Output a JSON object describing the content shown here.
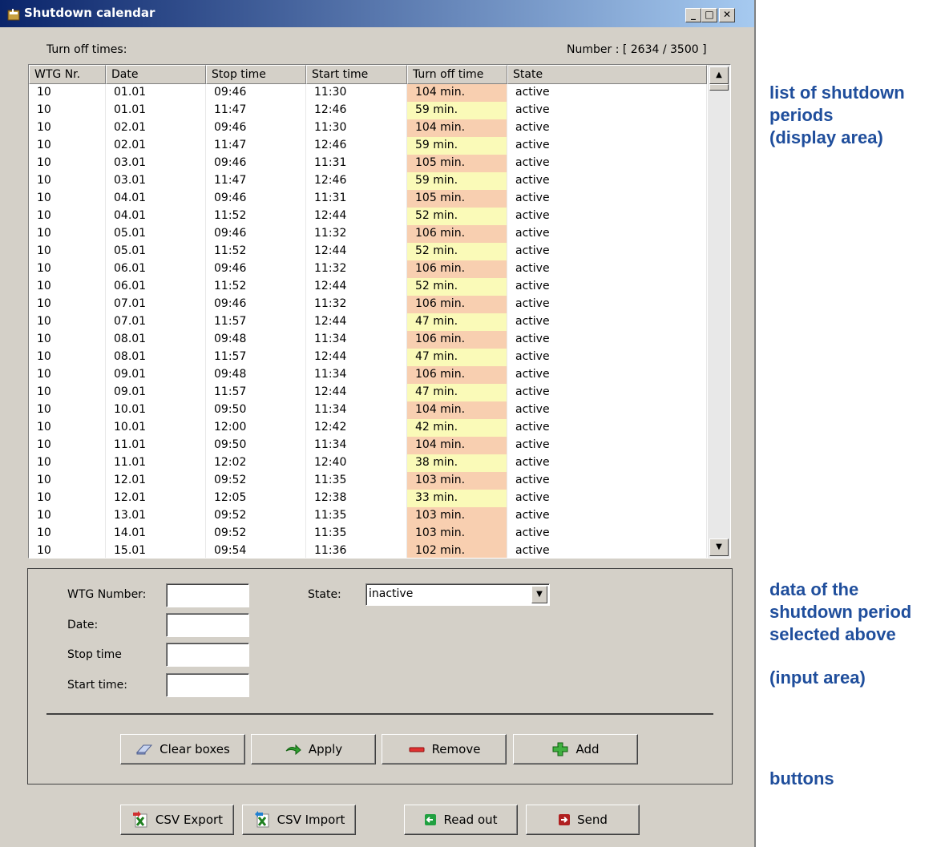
{
  "window": {
    "title": "Shutdown calendar",
    "controls": {
      "minimize": "_",
      "maximize": "□",
      "close": "✕"
    }
  },
  "list": {
    "label": "Turn off times:",
    "count_text": "Number : [ 2634 / 3500 ]",
    "columns": [
      "WTG Nr.",
      "Date",
      "Stop time",
      "Start time",
      "Turn off time",
      "State"
    ],
    "rows": [
      {
        "wtg": "10",
        "date": "01.01",
        "stop": "09:46",
        "start": "11:30",
        "off": "104 min.",
        "state": "active"
      },
      {
        "wtg": "10",
        "date": "01.01",
        "stop": "11:47",
        "start": "12:46",
        "off": "59 min.",
        "state": "active"
      },
      {
        "wtg": "10",
        "date": "02.01",
        "stop": "09:46",
        "start": "11:30",
        "off": "104 min.",
        "state": "active"
      },
      {
        "wtg": "10",
        "date": "02.01",
        "stop": "11:47",
        "start": "12:46",
        "off": "59 min.",
        "state": "active"
      },
      {
        "wtg": "10",
        "date": "03.01",
        "stop": "09:46",
        "start": "11:31",
        "off": "105 min.",
        "state": "active"
      },
      {
        "wtg": "10",
        "date": "03.01",
        "stop": "11:47",
        "start": "12:46",
        "off": "59 min.",
        "state": "active"
      },
      {
        "wtg": "10",
        "date": "04.01",
        "stop": "09:46",
        "start": "11:31",
        "off": "105 min.",
        "state": "active"
      },
      {
        "wtg": "10",
        "date": "04.01",
        "stop": "11:52",
        "start": "12:44",
        "off": "52 min.",
        "state": "active"
      },
      {
        "wtg": "10",
        "date": "05.01",
        "stop": "09:46",
        "start": "11:32",
        "off": "106 min.",
        "state": "active"
      },
      {
        "wtg": "10",
        "date": "05.01",
        "stop": "11:52",
        "start": "12:44",
        "off": "52 min.",
        "state": "active"
      },
      {
        "wtg": "10",
        "date": "06.01",
        "stop": "09:46",
        "start": "11:32",
        "off": "106 min.",
        "state": "active"
      },
      {
        "wtg": "10",
        "date": "06.01",
        "stop": "11:52",
        "start": "12:44",
        "off": "52 min.",
        "state": "active"
      },
      {
        "wtg": "10",
        "date": "07.01",
        "stop": "09:46",
        "start": "11:32",
        "off": "106 min.",
        "state": "active"
      },
      {
        "wtg": "10",
        "date": "07.01",
        "stop": "11:57",
        "start": "12:44",
        "off": "47 min.",
        "state": "active"
      },
      {
        "wtg": "10",
        "date": "08.01",
        "stop": "09:48",
        "start": "11:34",
        "off": "106 min.",
        "state": "active"
      },
      {
        "wtg": "10",
        "date": "08.01",
        "stop": "11:57",
        "start": "12:44",
        "off": "47 min.",
        "state": "active"
      },
      {
        "wtg": "10",
        "date": "09.01",
        "stop": "09:48",
        "start": "11:34",
        "off": "106 min.",
        "state": "active"
      },
      {
        "wtg": "10",
        "date": "09.01",
        "stop": "11:57",
        "start": "12:44",
        "off": "47 min.",
        "state": "active"
      },
      {
        "wtg": "10",
        "date": "10.01",
        "stop": "09:50",
        "start": "11:34",
        "off": "104 min.",
        "state": "active"
      },
      {
        "wtg": "10",
        "date": "10.01",
        "stop": "12:00",
        "start": "12:42",
        "off": "42 min.",
        "state": "active"
      },
      {
        "wtg": "10",
        "date": "11.01",
        "stop": "09:50",
        "start": "11:34",
        "off": "104 min.",
        "state": "active"
      },
      {
        "wtg": "10",
        "date": "11.01",
        "stop": "12:02",
        "start": "12:40",
        "off": "38 min.",
        "state": "active"
      },
      {
        "wtg": "10",
        "date": "12.01",
        "stop": "09:52",
        "start": "11:35",
        "off": "103 min.",
        "state": "active"
      },
      {
        "wtg": "10",
        "date": "12.01",
        "stop": "12:05",
        "start": "12:38",
        "off": "33 min.",
        "state": "active"
      },
      {
        "wtg": "10",
        "date": "13.01",
        "stop": "09:52",
        "start": "11:35",
        "off": "103 min.",
        "state": "active"
      },
      {
        "wtg": "10",
        "date": "14.01",
        "stop": "09:52",
        "start": "11:35",
        "off": "103 min.",
        "state": "active"
      },
      {
        "wtg": "10",
        "date": "15.01",
        "stop": "09:54",
        "start": "11:36",
        "off": "102 min.",
        "state": "active"
      }
    ],
    "colors": {
      "long_off": "#f8cfb0",
      "short_off": "#fafab8"
    }
  },
  "form": {
    "wtg_label": "WTG Number:",
    "wtg_value": "",
    "date_label": "Date:",
    "date_value": "",
    "stop_label": "Stop time",
    "stop_value": "",
    "start_label": "Start time:",
    "start_value": "",
    "state_label": "State:",
    "state_value": "inactive"
  },
  "buttons": {
    "clear": "Clear boxes",
    "apply": "Apply",
    "remove": "Remove",
    "add": "Add"
  },
  "bottom_buttons": {
    "csv_export": "CSV Export",
    "csv_import": "CSV Import",
    "read_out": "Read out",
    "send": "Send"
  },
  "annotations": {
    "display": [
      "list of shutdown",
      "periods",
      "(display area)"
    ],
    "input": [
      "data of the",
      "shutdown period",
      "selected above"
    ],
    "input_sub": "(input area)",
    "buttons": "buttons"
  }
}
